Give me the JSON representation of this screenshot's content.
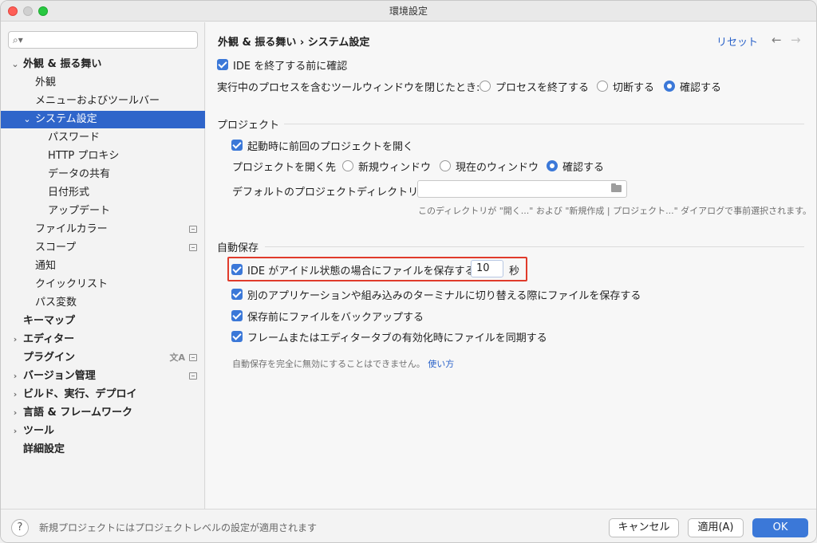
{
  "window": {
    "title": "環境設定"
  },
  "search": {
    "placeholder": ""
  },
  "sidebar": {
    "items": [
      {
        "label": "外観 & 振る舞い",
        "arrow": "⌄"
      },
      {
        "label": "外観"
      },
      {
        "label": "メニューおよびツールバー"
      },
      {
        "label": "システム設定",
        "arrow": "⌄"
      },
      {
        "label": "パスワード"
      },
      {
        "label": "HTTP プロキシ"
      },
      {
        "label": "データの共有"
      },
      {
        "label": "日付形式"
      },
      {
        "label": "アップデート"
      },
      {
        "label": "ファイルカラー"
      },
      {
        "label": "スコープ"
      },
      {
        "label": "通知"
      },
      {
        "label": "クイックリスト"
      },
      {
        "label": "パス変数"
      },
      {
        "label": "キーマップ"
      },
      {
        "label": "エディター",
        "arrow": "›"
      },
      {
        "label": "プラグイン"
      },
      {
        "label": "バージョン管理",
        "arrow": "›"
      },
      {
        "label": "ビルド、実行、デプロイ",
        "arrow": "›"
      },
      {
        "label": "言語 & フレームワーク",
        "arrow": "›"
      },
      {
        "label": "ツール",
        "arrow": "›"
      },
      {
        "label": "詳細設定"
      }
    ]
  },
  "header": {
    "breadcrumb": "外観 & 振る舞い  ›  システム設定",
    "reset": "リセット",
    "back": "←",
    "forward": "→"
  },
  "general": {
    "confirm_exit": "IDE を終了する前に確認",
    "close_tool_label": "実行中のプロセスを含むツールウィンドウを閉じたとき:",
    "opt_terminate": "プロセスを終了する",
    "opt_disconnect": "切断する",
    "opt_ask": "確認する"
  },
  "project": {
    "section_title": "プロジェクト",
    "reopen_last": "起動時に前回のプロジェクトを開く",
    "open_target_label": "プロジェクトを開く先",
    "opt_new_window": "新規ウィンドウ",
    "opt_current_window": "現在のウィンドウ",
    "opt_ask": "確認する",
    "default_dir_label": "デフォルトのプロジェクトディレクトリ:",
    "default_dir_value": "",
    "default_dir_hint": "このディレクトリが \"開く...\" および \"新規作成 | プロジェクト...\" ダイアログで事前選択されます。"
  },
  "autosave": {
    "section_title": "自動保存",
    "idle_save_label": "IDE がアイドル状態の場合にファイルを保存する:",
    "idle_seconds": "10",
    "seconds_unit": "秒",
    "switch_app_save": "別のアプリケーションや組み込みのターミナルに切り替える際にファイルを保存する",
    "backup_before_save": "保存前にファイルをバックアップする",
    "sync_on_frame": "フレームまたはエディタータブの有効化時にファイルを同期する",
    "disable_note": "自動保存を完全に無効にすることはできません。",
    "howto_link": "使い方"
  },
  "footer": {
    "help": "?",
    "message": "新規プロジェクトにはプロジェクトレベルの設定が適用されます",
    "cancel": "キャンセル",
    "apply": "適用(A)",
    "ok": "OK"
  },
  "colors": {
    "accent": "#3b78d8",
    "selection": "#2f65ca",
    "highlight_border": "#e03b2b",
    "link": "#2a62c9"
  }
}
